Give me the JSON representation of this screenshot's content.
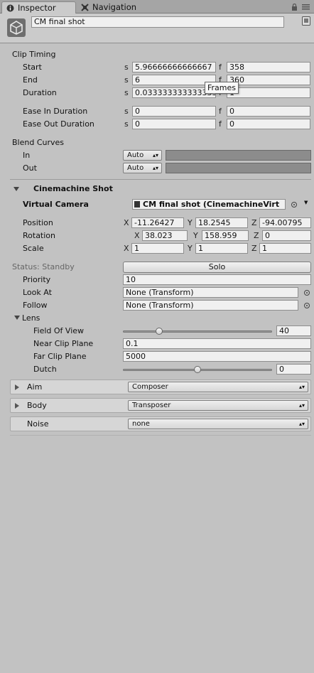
{
  "tabs": {
    "inspector": "Inspector",
    "navigation": "Navigation"
  },
  "header": {
    "object_name": "CM final shot"
  },
  "clip_timing": {
    "title": "Clip Timing",
    "start": {
      "label": "Start",
      "s_prefix": "s",
      "s_value": "5.96666666666667",
      "f_prefix": "f",
      "f_value": "358"
    },
    "end": {
      "label": "End",
      "s_prefix": "s",
      "s_value": "6",
      "f_prefix": "f",
      "f_value": "360"
    },
    "duration": {
      "label": "Duration",
      "s_prefix": "s",
      "s_value": "0.0333333333333335",
      "f_prefix": "f",
      "f_value": "1"
    },
    "tooltip": "Frames",
    "ease_in": {
      "label": "Ease In Duration",
      "s_prefix": "s",
      "s_value": "0",
      "f_prefix": "f",
      "f_value": "0"
    },
    "ease_out": {
      "label": "Ease Out Duration",
      "s_prefix": "s",
      "s_value": "0",
      "f_prefix": "f",
      "f_value": "0"
    }
  },
  "blend_curves": {
    "title": "Blend Curves",
    "in": {
      "label": "In",
      "mode": "Auto"
    },
    "out": {
      "label": "Out",
      "mode": "Auto"
    }
  },
  "cinemachine_shot": {
    "title": "Cinemachine Shot",
    "virtual_camera": {
      "label": "Virtual Camera",
      "value": "CM final shot (CinemachineVirt"
    },
    "position": {
      "label": "Position",
      "x": "-11.26427",
      "y": "18.2545",
      "z": "-94.00795"
    },
    "rotation": {
      "label": "Rotation",
      "x": "38.023",
      "y": "158.959",
      "z": "0"
    },
    "scale": {
      "label": "Scale",
      "x": "1",
      "y": "1",
      "z": "1"
    },
    "axis": {
      "x": "X",
      "y": "Y",
      "z": "Z"
    }
  },
  "status": {
    "label": "Status: Standby",
    "solo_button": "Solo"
  },
  "priority": {
    "label": "Priority",
    "value": "10"
  },
  "look_at": {
    "label": "Look At",
    "value": "None (Transform)"
  },
  "follow": {
    "label": "Follow",
    "value": "None (Transform)"
  },
  "lens": {
    "title": "Lens",
    "fov": {
      "label": "Field Of View",
      "value": "40",
      "fraction": 0.23
    },
    "near": {
      "label": "Near Clip Plane",
      "value": "0.1"
    },
    "far": {
      "label": "Far Clip Plane",
      "value": "5000"
    },
    "dutch": {
      "label": "Dutch",
      "value": "0",
      "fraction": 0.5
    }
  },
  "pipeline": {
    "aim": {
      "label": "Aim",
      "value": "Composer"
    },
    "body": {
      "label": "Body",
      "value": "Transposer"
    },
    "noise": {
      "label": "Noise",
      "value": "none"
    }
  },
  "icons": {
    "inspector_tab": "info-icon",
    "navigation_tab": "navigation-icon",
    "lock": "lock-icon",
    "menu": "menu-icon",
    "object": "unity-logo-icon",
    "help": "help-book-icon",
    "object_picker": "target-icon",
    "dropdown": "dropdown-arrow-icon"
  }
}
